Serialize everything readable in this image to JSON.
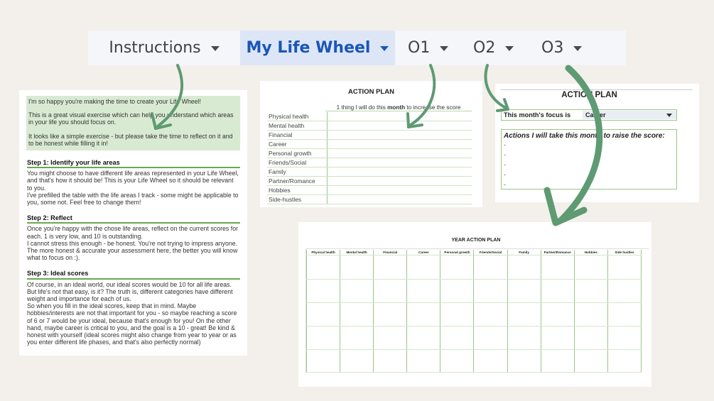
{
  "tabs": [
    {
      "label": "Instructions",
      "active": false
    },
    {
      "label": "My Life Wheel",
      "active": true
    },
    {
      "label": "O1",
      "active": false
    },
    {
      "label": "O2",
      "active": false
    },
    {
      "label": "O3",
      "active": false
    }
  ],
  "instructions": {
    "intro": [
      "I'm so happy you're making the time to create your Life Wheel!",
      "This is a great visual exercise which can help you understand which areas in your life you should focus on.",
      "It looks like a simple exercise - but please take the time to reflect on it and to be honest while filling it in!"
    ],
    "steps": [
      {
        "title": "Step 1: Identify your life areas",
        "body": "You might choose to have different life areas represented in your Life Wheel, and that's how it should be! This is your Life Wheel so it should be relevant to you.\nI've prefilled the table with the life areas I track - some might be applicable to you, some not. Feel free to change them!"
      },
      {
        "title": "Step 2: Reflect",
        "body": "Once you're happy with the chose life areas, reflect on the current scores for each. 1 is very low, and 10 is outstanding.\nI cannot stress this enough - be honest. You're not trying to impress anyone. The more honest & accurate your assessment here, the better you will know what to focus on :)."
      },
      {
        "title": "Step 3: Ideal scores",
        "body": "Of course, in an ideal world, our ideal scores would be 10 for all life areas. But life's not that easy, is it? The truth is, different categories have different weight and importance for each of us.\nSo when you fill in the ideal scores, keep that in mind. Maybe hobbies/interests are not that important for you - so maybe reaching a score of 6 or 7 would be your ideal, because that's enough for you! On the other hand, maybe career is critical to you, and the goal is a 10 - great! Be kind & honest with yourself (ideal scores might also change from year to year or as you enter different life phases, and that's also perfectly normal)"
      }
    ]
  },
  "action_plan_monthly": {
    "title": "ACTION PLAN",
    "header_prefix": "1 thing I will do this ",
    "header_bold": "month",
    "header_suffix": " to increase the score",
    "areas": [
      "Physical health",
      "Mental health",
      "Financial",
      "Career",
      "Personal growth",
      "Friends/Social",
      "Family",
      "Partner/Romance",
      "Hobbies",
      "Side-hustles"
    ]
  },
  "action_plan_focus": {
    "title": "ACTION PLAN",
    "focus_label": "This month's focus is",
    "focus_value": "Career",
    "actions_label": "Actions I will take this month to raise the score:",
    "bullets": [
      "-",
      "-",
      "-",
      "-",
      "-"
    ]
  },
  "year_action_plan": {
    "title": "YEAR ACTION PLAN",
    "columns": [
      "Physical health",
      "Mental health",
      "Financial",
      "Career",
      "Personal growth",
      "Friends/Social",
      "Family",
      "Partner/Romance",
      "Hobbies",
      "Side hustles"
    ]
  },
  "colors": {
    "background": "#f3efeb",
    "arrow": "#5e9a72",
    "active_tab_text": "#1a56b8",
    "active_tab_bg": "#dde6f6",
    "intro_bg": "#d9ead3",
    "table_line": "#9cc58a"
  }
}
